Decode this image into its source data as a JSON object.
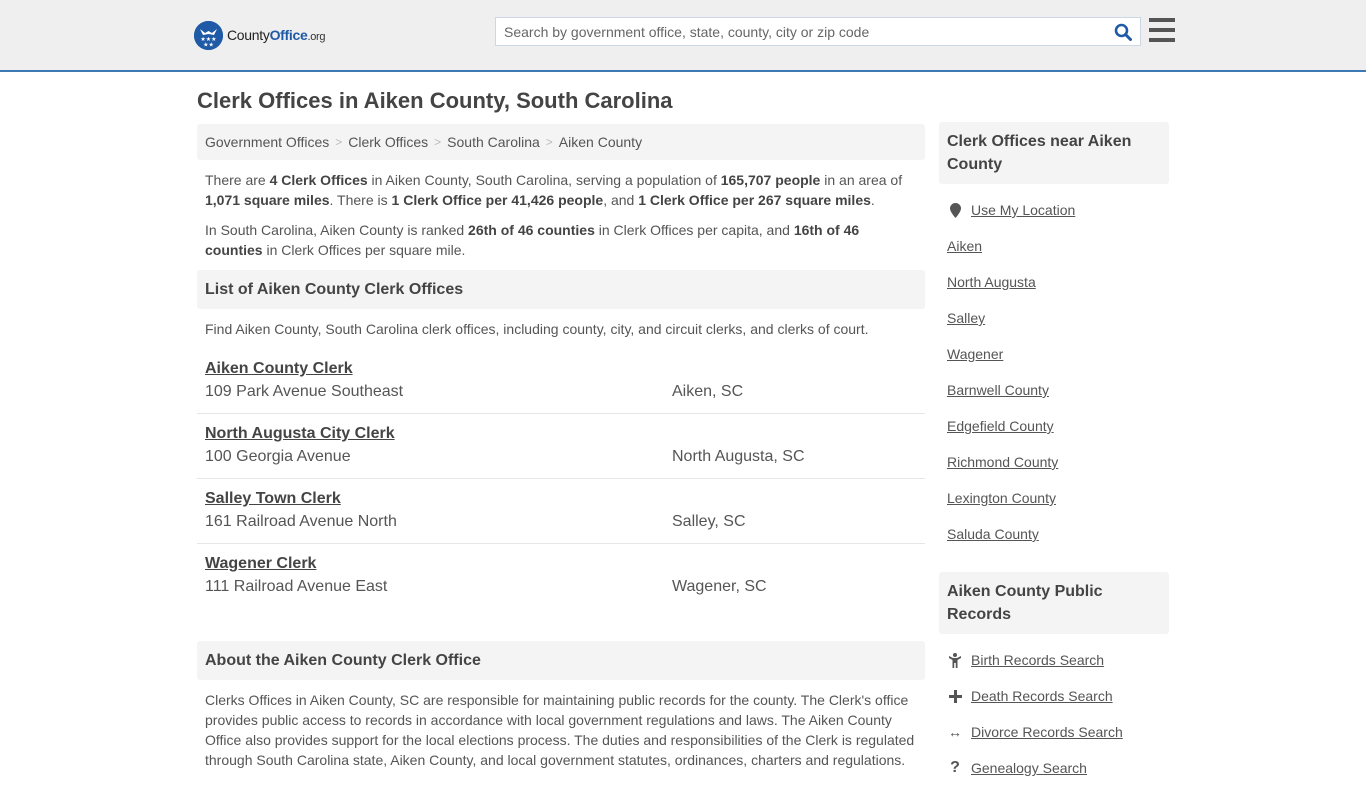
{
  "header": {
    "logo": {
      "brand_prefix": "County",
      "brand_main": "Office",
      "brand_suffix": ".org",
      "icon": "eagle-stars-badge-icon"
    },
    "search": {
      "placeholder": "Search by government office, state, county, city or zip code",
      "value": "",
      "icon": "search-icon"
    },
    "menu_icon": "hamburger-menu-icon"
  },
  "page": {
    "title": "Clerk Offices in Aiken County, South Carolina"
  },
  "breadcrumb": [
    {
      "label": "Government Offices"
    },
    {
      "label": "Clerk Offices"
    },
    {
      "label": "South Carolina"
    },
    {
      "label": "Aiken County"
    }
  ],
  "breadcrumb_separator": ">",
  "intro": {
    "p1": {
      "t1": "There are ",
      "b1": "4 Clerk Offices",
      "t2": " in Aiken County, South Carolina, serving a population of ",
      "b2": "165,707 people",
      "t3": " in an area of ",
      "b3": "1,071 square miles",
      "t4": ". There is ",
      "b4": "1 Clerk Office per 41,426 people",
      "t5": ", and ",
      "b5": "1 Clerk Office per 267 square miles",
      "t6": "."
    },
    "p2": {
      "t1": "In South Carolina, Aiken County is ranked ",
      "b1": "26th of 46 counties",
      "t2": " in Clerk Offices per capita, and ",
      "b2": "16th of 46 counties",
      "t3": " in Clerk Offices per square mile."
    }
  },
  "list_section": {
    "title": "List of Aiken County Clerk Offices",
    "description": "Find Aiken County, South Carolina clerk offices, including county, city, and circuit clerks, and clerks of court.",
    "offices": [
      {
        "name": "Aiken County Clerk",
        "address": "109 Park Avenue Southeast",
        "city": "Aiken, SC"
      },
      {
        "name": "North Augusta City Clerk",
        "address": "100 Georgia Avenue",
        "city": "North Augusta, SC"
      },
      {
        "name": "Salley Town Clerk",
        "address": "161 Railroad Avenue North",
        "city": "Salley, SC"
      },
      {
        "name": "Wagener Clerk",
        "address": "111 Railroad Avenue East",
        "city": "Wagener, SC"
      }
    ]
  },
  "about_section": {
    "title": "About the Aiken County Clerk Office",
    "text": "Clerks Offices in Aiken County, SC are responsible for maintaining public records for the county. The Clerk's office provides public access to records in accordance with local government regulations and laws. The Aiken County Office also provides support for the local elections process. The duties and responsibilities of the Clerk is regulated through South Carolina state, Aiken County, and local government statutes, ordinances, charters and regulations."
  },
  "sidebar": {
    "nearby": {
      "title": "Clerk Offices near Aiken County",
      "use_location": {
        "label": "Use My Location",
        "icon": "map-marker-icon"
      },
      "items": [
        {
          "label": "Aiken"
        },
        {
          "label": "North Augusta"
        },
        {
          "label": "Salley"
        },
        {
          "label": "Wagener"
        },
        {
          "label": "Barnwell County"
        },
        {
          "label": "Edgefield County"
        },
        {
          "label": "Richmond County"
        },
        {
          "label": "Lexington County"
        },
        {
          "label": "Saluda County"
        }
      ]
    },
    "records": {
      "title": "Aiken County Public Records",
      "items": [
        {
          "label": "Birth Records Search",
          "icon": "child-icon",
          "glyph": "⚲"
        },
        {
          "label": "Death Records Search",
          "icon": "plus-icon",
          "glyph": "+"
        },
        {
          "label": "Divorce Records Search",
          "icon": "arrows-horizontal-icon",
          "glyph": "↔"
        },
        {
          "label": "Genealogy Search",
          "icon": "question-icon",
          "glyph": "?"
        }
      ]
    }
  },
  "colors": {
    "brand_blue": "#1f5aa6",
    "header_bg": "#efefef",
    "header_border": "#3c78b4",
    "text": "#555555",
    "heading": "#444444",
    "panel_bg": "#f4f4f4"
  }
}
